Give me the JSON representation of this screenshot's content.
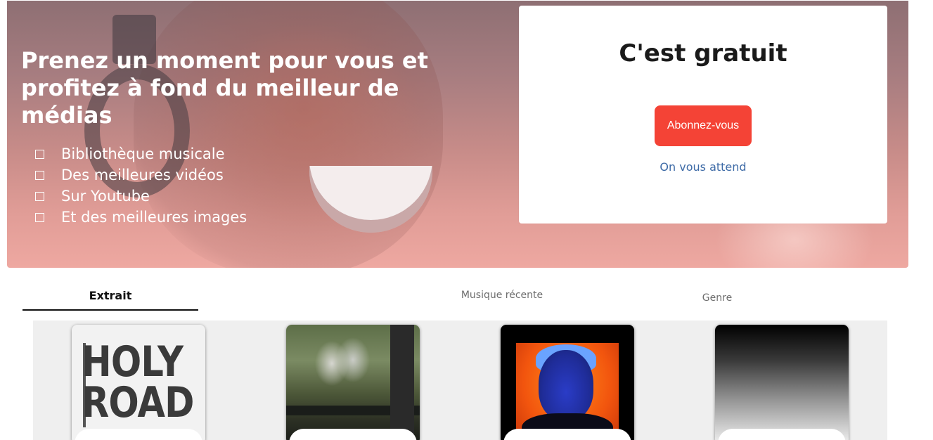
{
  "hero": {
    "title": "Prenez un moment pour vous et profitez à fond du meilleur de médias",
    "features": [
      "Bibliothèque musicale",
      "Des meilleures vidéos",
      "Sur Youtube",
      "Et des meilleures images"
    ]
  },
  "signup": {
    "title": "C'est gratuit",
    "button_label": "Abonnez-vous",
    "link_text": "On vous attend"
  },
  "tabs": [
    {
      "label": "Extrait",
      "active": true
    },
    {
      "label": "Musique récente",
      "active": false
    },
    {
      "label": "Genre",
      "active": false
    }
  ],
  "albums": [
    {
      "cover_text": "HOLY ROAD"
    },
    {
      "cover_text": ""
    },
    {
      "cover_text": ""
    },
    {
      "cover_text": ""
    }
  ],
  "colors": {
    "accent": "#f44336",
    "link": "#3d6aa6",
    "gallery_bg": "#efefef"
  }
}
